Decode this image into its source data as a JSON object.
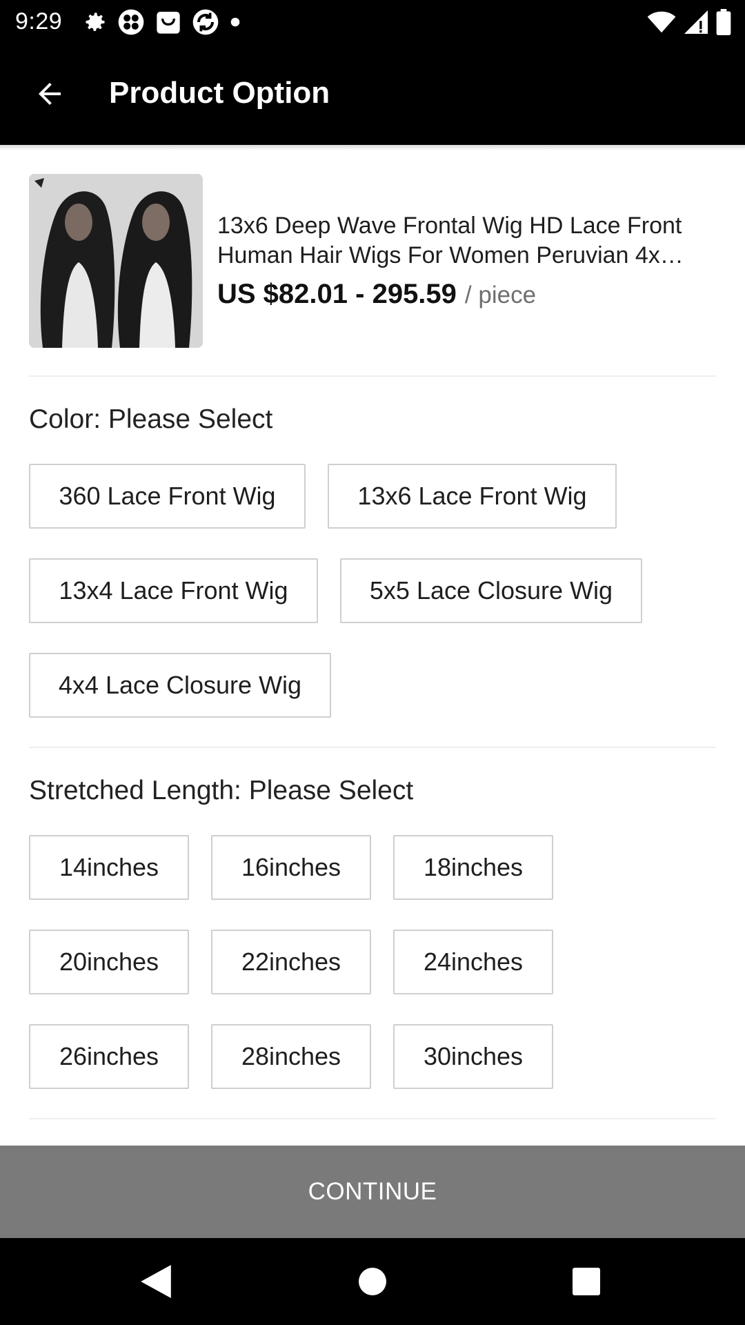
{
  "status_bar": {
    "time": "9:29",
    "left_icons": [
      "gear-icon",
      "pinwheel-icon",
      "bag-icon",
      "sync-icon",
      "dot-icon"
    ],
    "right_icons": [
      "wifi-icon",
      "signal-icon",
      "battery-icon"
    ]
  },
  "app_bar": {
    "back_icon": "arrow-back-icon",
    "title": "Product Option"
  },
  "product": {
    "image_desc": "product-photo",
    "title": "13x6 Deep Wave Frontal Wig HD Lace Front Human Hair Wigs For Women Peruvian 4x…",
    "price": "US $82.01 - 295.59",
    "unit": "/ piece"
  },
  "color_section": {
    "label": "Color: Please Select",
    "options": [
      "360 Lace Front Wig",
      "13x6 Lace Front Wig",
      "13x4 Lace Front Wig",
      "5x5 Lace Closure Wig",
      "4x4 Lace Closure Wig"
    ]
  },
  "length_section": {
    "label": "Stretched Length: Please Select",
    "options": [
      "14inches",
      "16inches",
      "18inches",
      "20inches",
      "22inches",
      "24inches",
      "26inches",
      "28inches",
      "30inches"
    ]
  },
  "continue_label": "CONTINUE",
  "nav": {
    "back": "triangle-back-icon",
    "home": "circle-home-icon",
    "recents": "square-recents-icon"
  },
  "colors": {
    "bars": "#000000",
    "continue_bg": "#7a7a7a",
    "option_border": "#cfcfcf"
  }
}
